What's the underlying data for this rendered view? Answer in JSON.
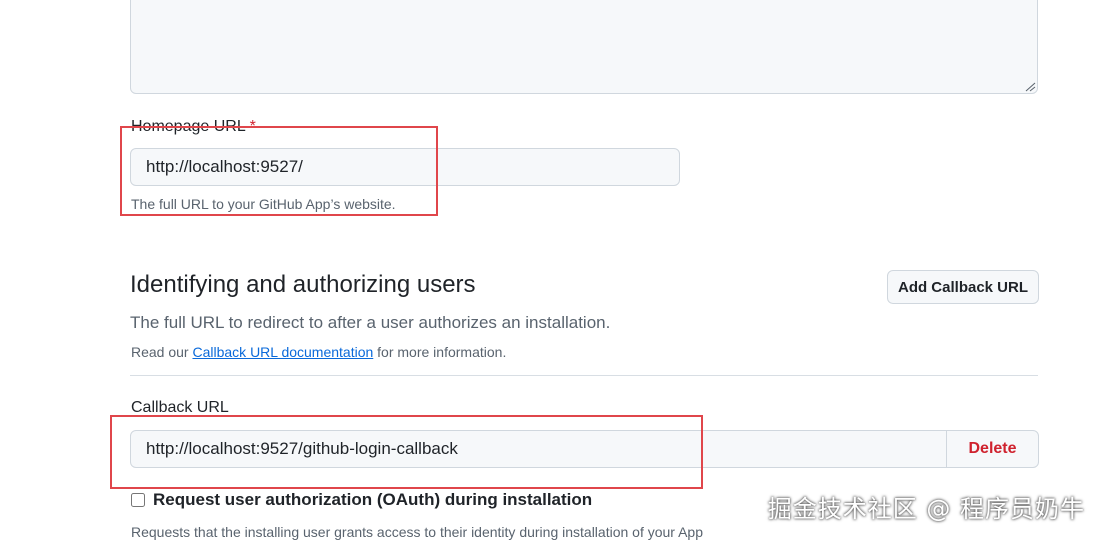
{
  "homepage": {
    "label": "Homepage URL",
    "required_mark": "*",
    "value": "http://localhost:9527/",
    "hint": "The full URL to your GitHub App’s website."
  },
  "identify": {
    "title": "Identifying and authorizing users",
    "add_button": "Add Callback URL",
    "description": "The full URL to redirect to after a user authorizes an installation.",
    "read_prefix": "Read our",
    "doc_link": "Callback URL documentation",
    "read_suffix": "for more information."
  },
  "callback": {
    "label": "Callback URL",
    "value": "http://localhost:9527/github-login-callback",
    "delete_label": "Delete"
  },
  "oauth": {
    "checkbox_label": "Request user authorization (OAuth) during installation",
    "checked": false,
    "hint": "Requests that the installing user grants access to their identity during installation of your App"
  },
  "watermark": "掘金技术社区 @ 程序员奶牛",
  "colors": {
    "highlight_box": "#e0464b",
    "danger": "#cf222e",
    "link": "#0969da"
  }
}
